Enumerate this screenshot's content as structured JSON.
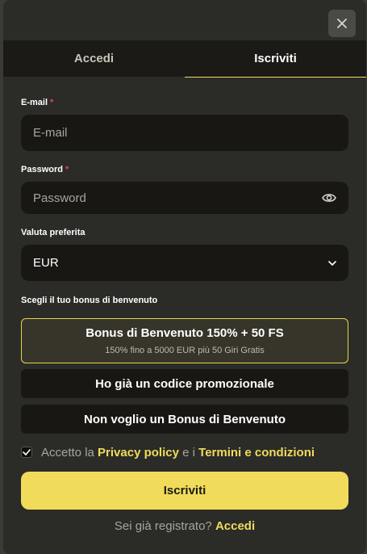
{
  "tabs": {
    "login": "Accedi",
    "register": "Iscriviti"
  },
  "email": {
    "label": "E-mail",
    "required": "*",
    "placeholder": "E-mail"
  },
  "password": {
    "label": "Password",
    "required": "*",
    "placeholder": "Password"
  },
  "currency": {
    "label": "Valuta preferita",
    "value": "EUR"
  },
  "bonus_section": {
    "label": "Scegli il tuo bonus di benvenuto",
    "options": [
      {
        "title": "Bonus di Benvenuto 150% + 50 FS",
        "subtitle": "150% fino a 5000 EUR più 50 Giri Gratis",
        "selected": true
      },
      {
        "title": "Ho già un codice promozionale",
        "selected": false
      },
      {
        "title": "Non voglio un Bonus di Benvenuto",
        "selected": false
      }
    ]
  },
  "terms": {
    "checked": true,
    "prefix": "Accetto la",
    "privacy_link": "Privacy policy",
    "joiner": "e i",
    "terms_link": "Termini e condizioni"
  },
  "submit_label": "Iscriviti",
  "footer": {
    "question": "Sei già registrato?",
    "login_link": "Accedi"
  },
  "colors": {
    "accent": "#f0dc5a",
    "required": "#e04848",
    "panel": "#2b2b28",
    "field": "#181714"
  },
  "icons": {
    "close": "close-icon",
    "eye": "eye-icon",
    "chevron": "chevron-down-icon",
    "check": "check-icon"
  }
}
